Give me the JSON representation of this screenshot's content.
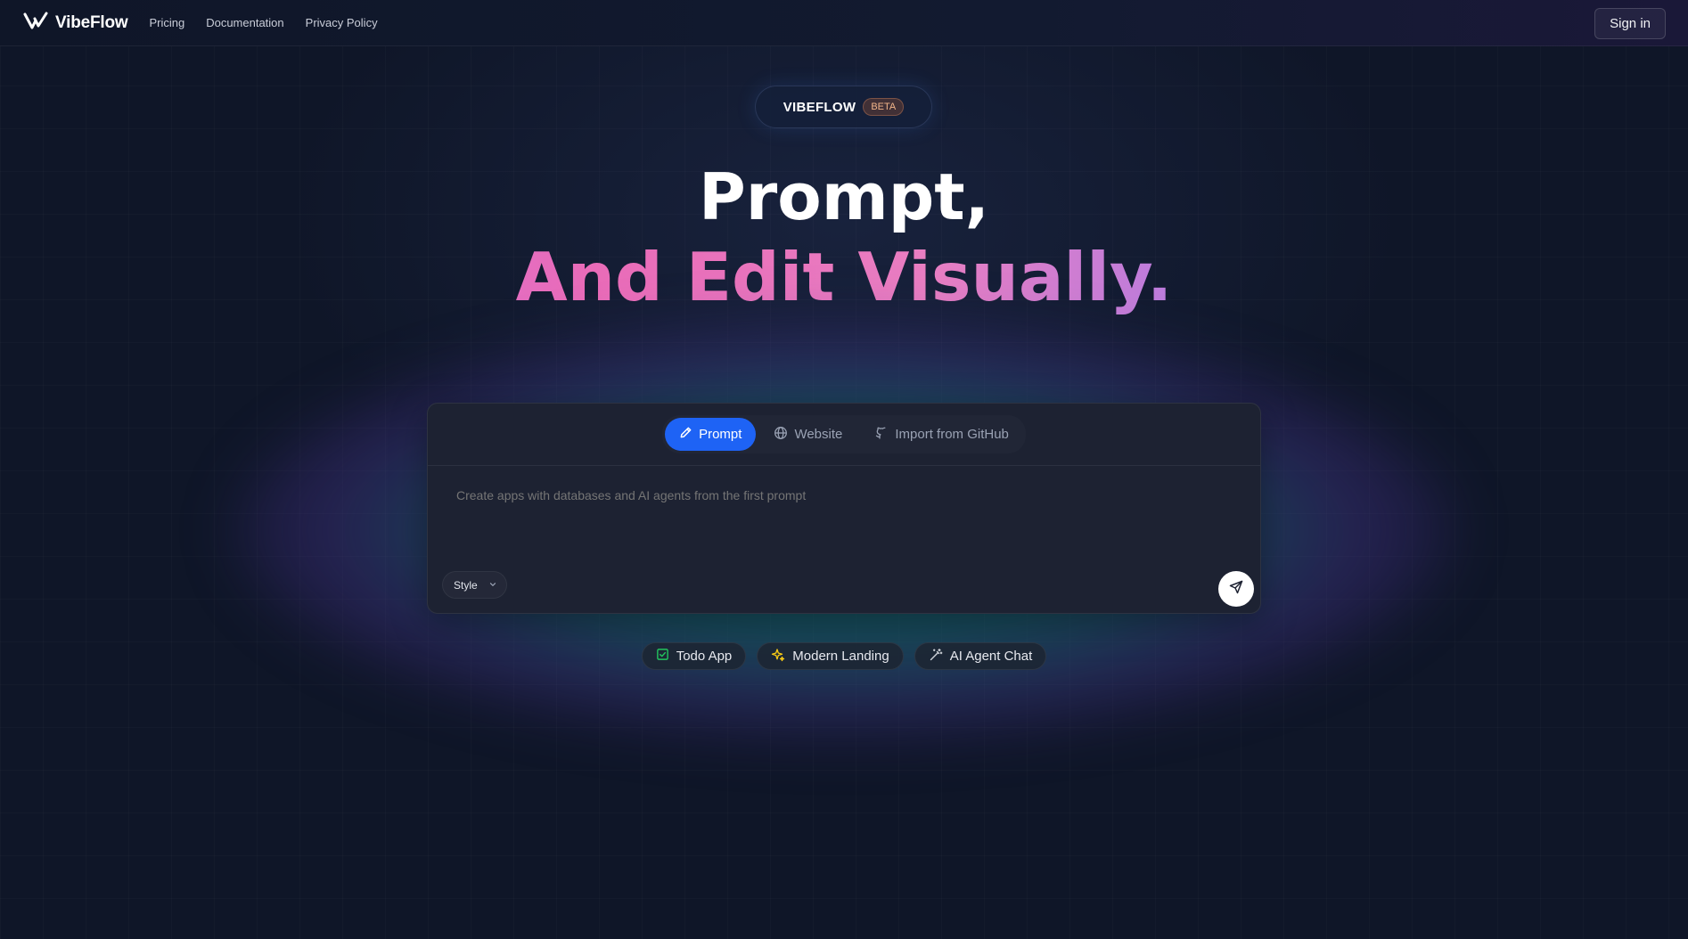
{
  "header": {
    "brand": "VibeFlow",
    "nav": [
      "Pricing",
      "Documentation",
      "Privacy Policy"
    ],
    "signin_label": "Sign in"
  },
  "hero": {
    "badge_name": "VIBEFLOW",
    "badge_tag": "BETA",
    "headline_line1": "Prompt,",
    "headline_line2": "And Edit Visually."
  },
  "composer": {
    "tabs": [
      {
        "label": "Prompt",
        "icon": "pencil-icon",
        "active": true
      },
      {
        "label": "Website",
        "icon": "globe-icon",
        "active": false
      },
      {
        "label": "Import from GitHub",
        "icon": "github-icon",
        "active": false
      }
    ],
    "placeholder": "Create apps with databases and AI agents from the first prompt",
    "style_label": "Style",
    "send_icon": "send-icon"
  },
  "suggestions": [
    {
      "label": "Todo App",
      "icon": "checkbox-icon",
      "color": "#22c55e"
    },
    {
      "label": "Modern Landing",
      "icon": "sparkles-icon",
      "color": "#facc15"
    },
    {
      "label": "AI Agent Chat",
      "icon": "magic-wand-icon",
      "color": "#d1d5db"
    }
  ],
  "colors": {
    "background": "#0f1628",
    "card": "#1d2232",
    "active_tab": "#1e63f5",
    "beta_text": "#f2b58a"
  }
}
